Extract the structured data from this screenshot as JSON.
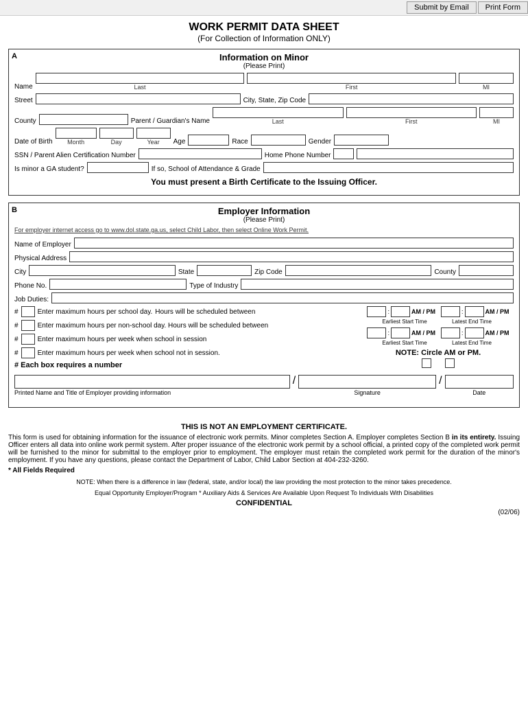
{
  "topbar": {
    "submit_email": "Submit by Email",
    "print_form": "Print Form"
  },
  "title": "WORK PERMIT DATA SHEET",
  "subtitle": "(For  Collection  of  Information  ONLY)",
  "section_a": {
    "label": "A",
    "title": "Information on Minor",
    "please_print": "(Please Print)",
    "name_label": "Name",
    "last_label": "Last",
    "first_label": "First",
    "mi_label": "MI",
    "street_label": "Street",
    "city_state_zip_label": "City, State, Zip Code",
    "county_label": "County",
    "guardian_label": "Parent / Guardian's Name",
    "guardian_last": "Last",
    "guardian_first": "First",
    "guardian_mi": "MI",
    "dob_label": "Date of Birth",
    "month_label": "Month",
    "day_label": "Day",
    "year_label": "Year",
    "age_label": "Age",
    "race_label": "Race",
    "gender_label": "Gender",
    "ssn_label": "SSN / Parent Alien Certification Number",
    "phone_label": "Home Phone Number",
    "ga_label": "Is minor a GA student?",
    "school_label": "If so, School of Attendance & Grade",
    "birth_cert_notice": "You must present a Birth Certificate to the Issuing Officer."
  },
  "section_b": {
    "label": "B",
    "title": "Employer Information",
    "please_print": "(Please Print)",
    "internet_note": "For employer internet access go to www.dol.state.ga.us, select Child Labor, then select Online Work Permit.",
    "employer_name_label": "Name of Employer",
    "physical_address_label": "Physical Address",
    "city_label": "City",
    "state_label": "State",
    "zip_label": "Zip Code",
    "county_label": "County",
    "phone_label": "Phone No.",
    "industry_label": "Type of Industry",
    "job_duties_label": "Job Duties:",
    "hash_label": "#",
    "school_day_label": "Enter maximum hours per school day.",
    "schedule_between": "Hours will be scheduled between",
    "non_school_label": "Enter maximum hours per non-school day.  Hours will be scheduled between",
    "per_week_school": "Enter maximum hours per week when school in session",
    "per_week_no_school": "Enter maximum hours per week when school not in session.",
    "hash_notice": "# Each box requires a number",
    "am_pm": "AM / PM",
    "earliest_start": "Earliest Start Time",
    "latest_end": "Latest End Time",
    "note_circle": "NOTE:  Circle AM or PM.",
    "printed_name_label": "Printed Name and Title of Employer providing  information",
    "signature_label": "Signature",
    "date_label": "Date"
  },
  "footer": {
    "not_employment": "THIS IS NOT AN EMPLOYMENT CERTIFICATE.",
    "body_text": "This form is used for obtaining information for the issuance of electronic work permits.  Minor completes Section A.  Employer completes Section B ",
    "body_bold": "in its entirety.",
    "body_text2": " Issuing Officer enters all data into online work permit system.  After proper issuance of the electronic work permit by a school official, a printed copy of the completed work permit will be furnished to the minor for submittal to the employer prior to employment.  The employer must retain the completed work permit for the duration of the minor's employment.  If you have any questions, please contact the Department of Labor, Child Labor Section at 404-232-3260.",
    "all_fields": "* All Fields Required",
    "note_law": "NOTE: When there is a difference in law (federal, state, and/or local) the law providing the most protection to the minor takes precedence.",
    "equal_opportunity": "Equal Opportunity Employer/Program * Auxiliary Aids & Services Are Available Upon Request To Individuals With Disabilities",
    "confidential": "CONFIDENTIAL",
    "version": "(02/06)"
  }
}
